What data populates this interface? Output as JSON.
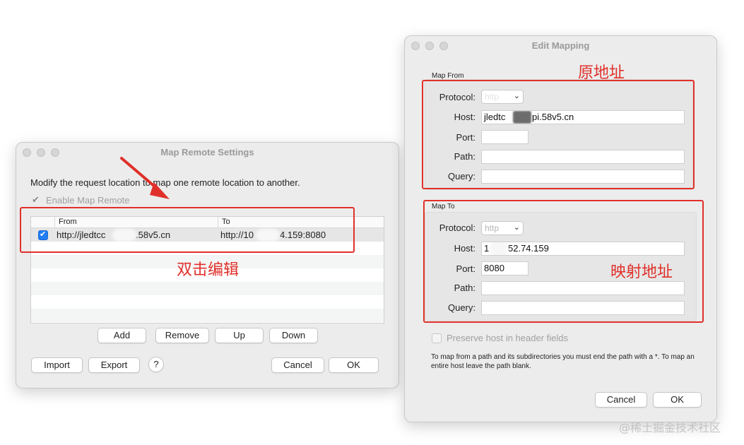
{
  "map_remote": {
    "title": "Map Remote Settings",
    "description": "Modify the request location to map one remote location to another.",
    "enable_label": "Enable Map Remote",
    "table": {
      "headers": [
        "From",
        "To"
      ],
      "rows": [
        {
          "from": "http://jledtcc",
          "from_tail": ".58v5.cn",
          "to": "http://10",
          "to_tail": "4.159:8080"
        }
      ]
    },
    "buttons": {
      "add": "Add",
      "remove": "Remove",
      "up": "Up",
      "down": "Down",
      "import": "Import",
      "export": "Export",
      "help": "?",
      "cancel": "Cancel",
      "ok": "OK"
    }
  },
  "edit_mapping": {
    "title": "Edit Mapping",
    "map_from": {
      "legend": "Map From",
      "protocol_label": "Protocol:",
      "protocol": "http",
      "host_label": "Host:",
      "host": "jledtc",
      "host_tail": "pi.58v5.cn",
      "port_label": "Port:",
      "port": "",
      "path_label": "Path:",
      "path": "",
      "query_label": "Query:",
      "query": ""
    },
    "map_to": {
      "legend": "Map To",
      "protocol_label": "Protocol:",
      "protocol": "http",
      "host_label": "Host:",
      "host": "1",
      "host_tail": "52.74.159",
      "port_label": "Port:",
      "port": "8080",
      "path_label": "Path:",
      "path": "",
      "query_label": "Query:",
      "query": ""
    },
    "preserve_label": "Preserve host in header fields",
    "help_text": "To map from a path and its subdirectories you must end the path with a *. To map an entire host leave the path blank.",
    "buttons": {
      "cancel": "Cancel",
      "ok": "OK"
    }
  },
  "annotations": {
    "double_click": "双击编辑",
    "original_address": "原地址",
    "mapped_address": "映射地址"
  },
  "watermark": "@稀土掘金技术社区"
}
